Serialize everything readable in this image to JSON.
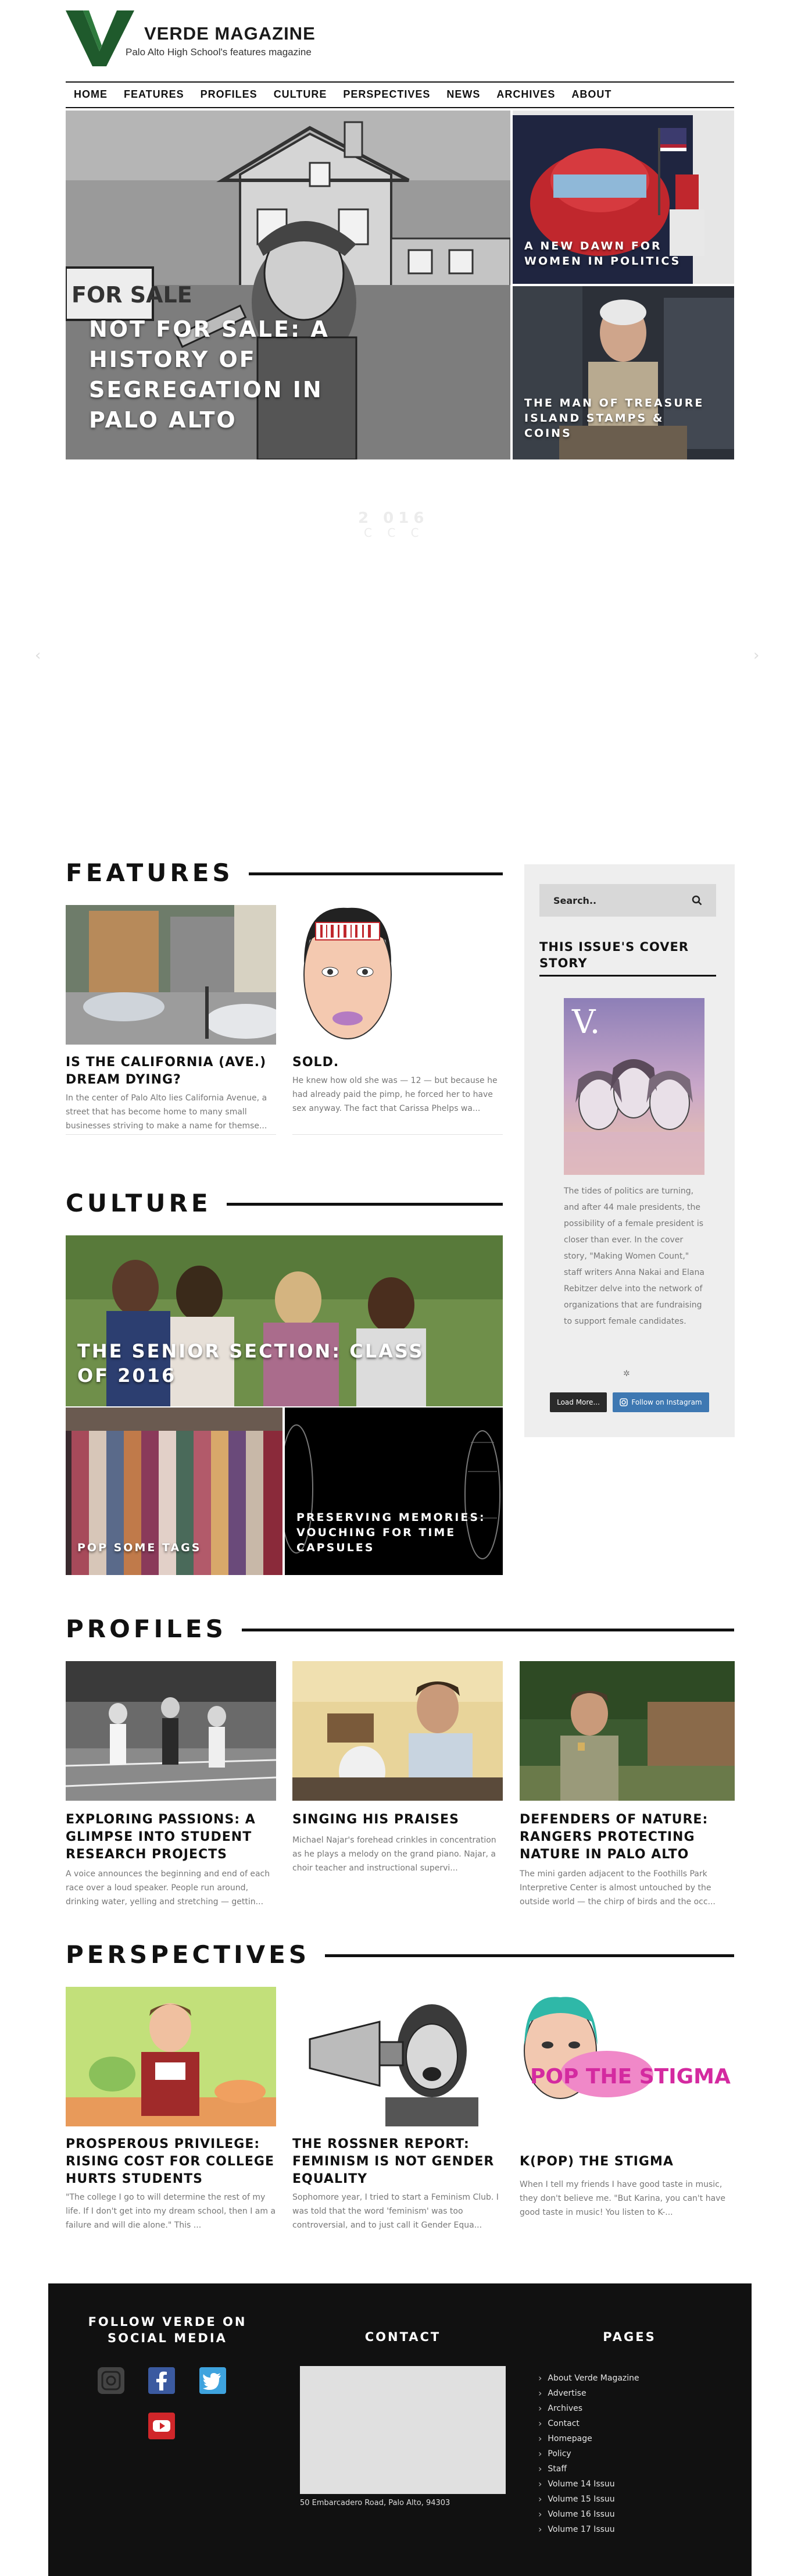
{
  "site": {
    "title": "VERDE MAGAZINE",
    "subtitle": "Palo Alto High School's features magazine"
  },
  "nav": [
    "HOME",
    "FEATURES",
    "PROFILES",
    "CULTURE",
    "PERSPECTIVES",
    "NEWS",
    "ARCHIVES",
    "ABOUT"
  ],
  "hero": {
    "main_title": "NOT FOR SALE: A HISTORY OF SEGREGATION IN PALO ALTO",
    "sign_text": "FOR SALE",
    "side": [
      {
        "title": "A NEW DAWN FOR WOMEN IN POLITICS"
      },
      {
        "title": "THE MAN OF TREASURE ISLAND STAMPS & COINS"
      }
    ]
  },
  "carousel": {
    "faint_text": "2 016",
    "faint_text2": "C C C"
  },
  "features": {
    "heading": "FEATURES",
    "cards": [
      {
        "title": "IS THE CALIFORNIA (AVE.) DREAM DYING?",
        "excerpt": "In the center of Palo Alto lies California Avenue, a street that has become home to many small businesses striving to make a name for themse..."
      },
      {
        "title": "SOLD.",
        "excerpt": "He knew how old she was — 12 — but because he had already paid the pimp, he forced her to have sex anyway. The fact that Carissa Phelps wa..."
      }
    ]
  },
  "culture": {
    "heading": "CULTURE",
    "main_title": "THE SENIOR SECTION: CLASS OF 2016",
    "tiles": [
      {
        "title": "POP SOME TAGS"
      },
      {
        "title": "PRESERVING MEMORIES: VOUCHING FOR TIME CAPSULES"
      }
    ]
  },
  "profiles": {
    "heading": "PROFILES",
    "cards": [
      {
        "title": "EXPLORING PASSIONS: A GLIMPSE INTO STUDENT RESEARCH PROJECTS",
        "excerpt": "A voice announces the beginning and end of each race over a loud speaker. People run around, drinking water, yelling and stretching — gettin..."
      },
      {
        "title": "SINGING HIS PRAISES",
        "excerpt": "Michael Najar's forehead crinkles in concentration as he plays a melody on the grand piano. Najar, a choir teacher and instructional supervi..."
      },
      {
        "title": "DEFENDERS OF NATURE: RANGERS PROTECTING NATURE IN PALO ALTO",
        "excerpt": "The mini garden adjacent to the Foothills Park Interpretive Center is almost untouched by the outside world — the chirp of birds and the occ..."
      }
    ]
  },
  "perspectives": {
    "heading": "PERSPECTIVES",
    "cards": [
      {
        "title": "PROSPEROUS PRIVILEGE: RISING COST FOR COLLEGE HURTS STUDENTS",
        "excerpt": "\"The college I go to will determine the rest of my life. If I don't get into my dream school, then I am a failure and will die alone.\" This ..."
      },
      {
        "title": "THE ROSSNER REPORT: FEMINISM IS NOT GENDER EQUALITY",
        "excerpt": "Sophomore year, I tried to start a Feminism Club. I was told that the word 'feminism' was too controversial, and to just call it Gender Equa..."
      },
      {
        "title": "K(POP) THE STIGMA",
        "excerpt": "When I tell my friends I have good taste in music, they don't believe me. \"But Karina, you can't have good taste in music! You listen to K-...",
        "art_text": "POP THE STIGMA"
      }
    ]
  },
  "sidebar": {
    "search_placeholder": "Search..",
    "cover_heading": "THIS ISSUE'S COVER STORY",
    "cover_letter": "V.",
    "cover_text": "The tides of politics are turning, and after 44 male presidents, the possibility of a female president is closer than ever. In the cover story, \"Making Women Count,\" staff writers Anna Nakai and Elana Rebitzer delve into the network of organizations that are fundraising to support female candidates.",
    "load_more": "Load More...",
    "follow_instagram": "Follow on Instagram"
  },
  "footer": {
    "social_heading": "FOLLOW VERDE ON SOCIAL MEDIA",
    "contact_heading": "CONTACT",
    "address": "50 Embarcadero Road, Palo Alto, 94303",
    "pages_heading": "PAGES",
    "pages": [
      "About Verde Magazine",
      "Advertise",
      "Archives",
      "Contact",
      "Homepage",
      "Policy",
      "Staff",
      "Volume 14 Issuu",
      "Volume 15 Issuu",
      "Volume 16 Issuu",
      "Volume 17 Issuu"
    ]
  },
  "colors": {
    "brand_green": "#1f5a2c",
    "footer_bg": "#111111",
    "instagram_blue": "#3e78b2",
    "facebook_blue": "#3b5aa0",
    "twitter_blue": "#3ea3de",
    "youtube_red": "#d0262a"
  }
}
